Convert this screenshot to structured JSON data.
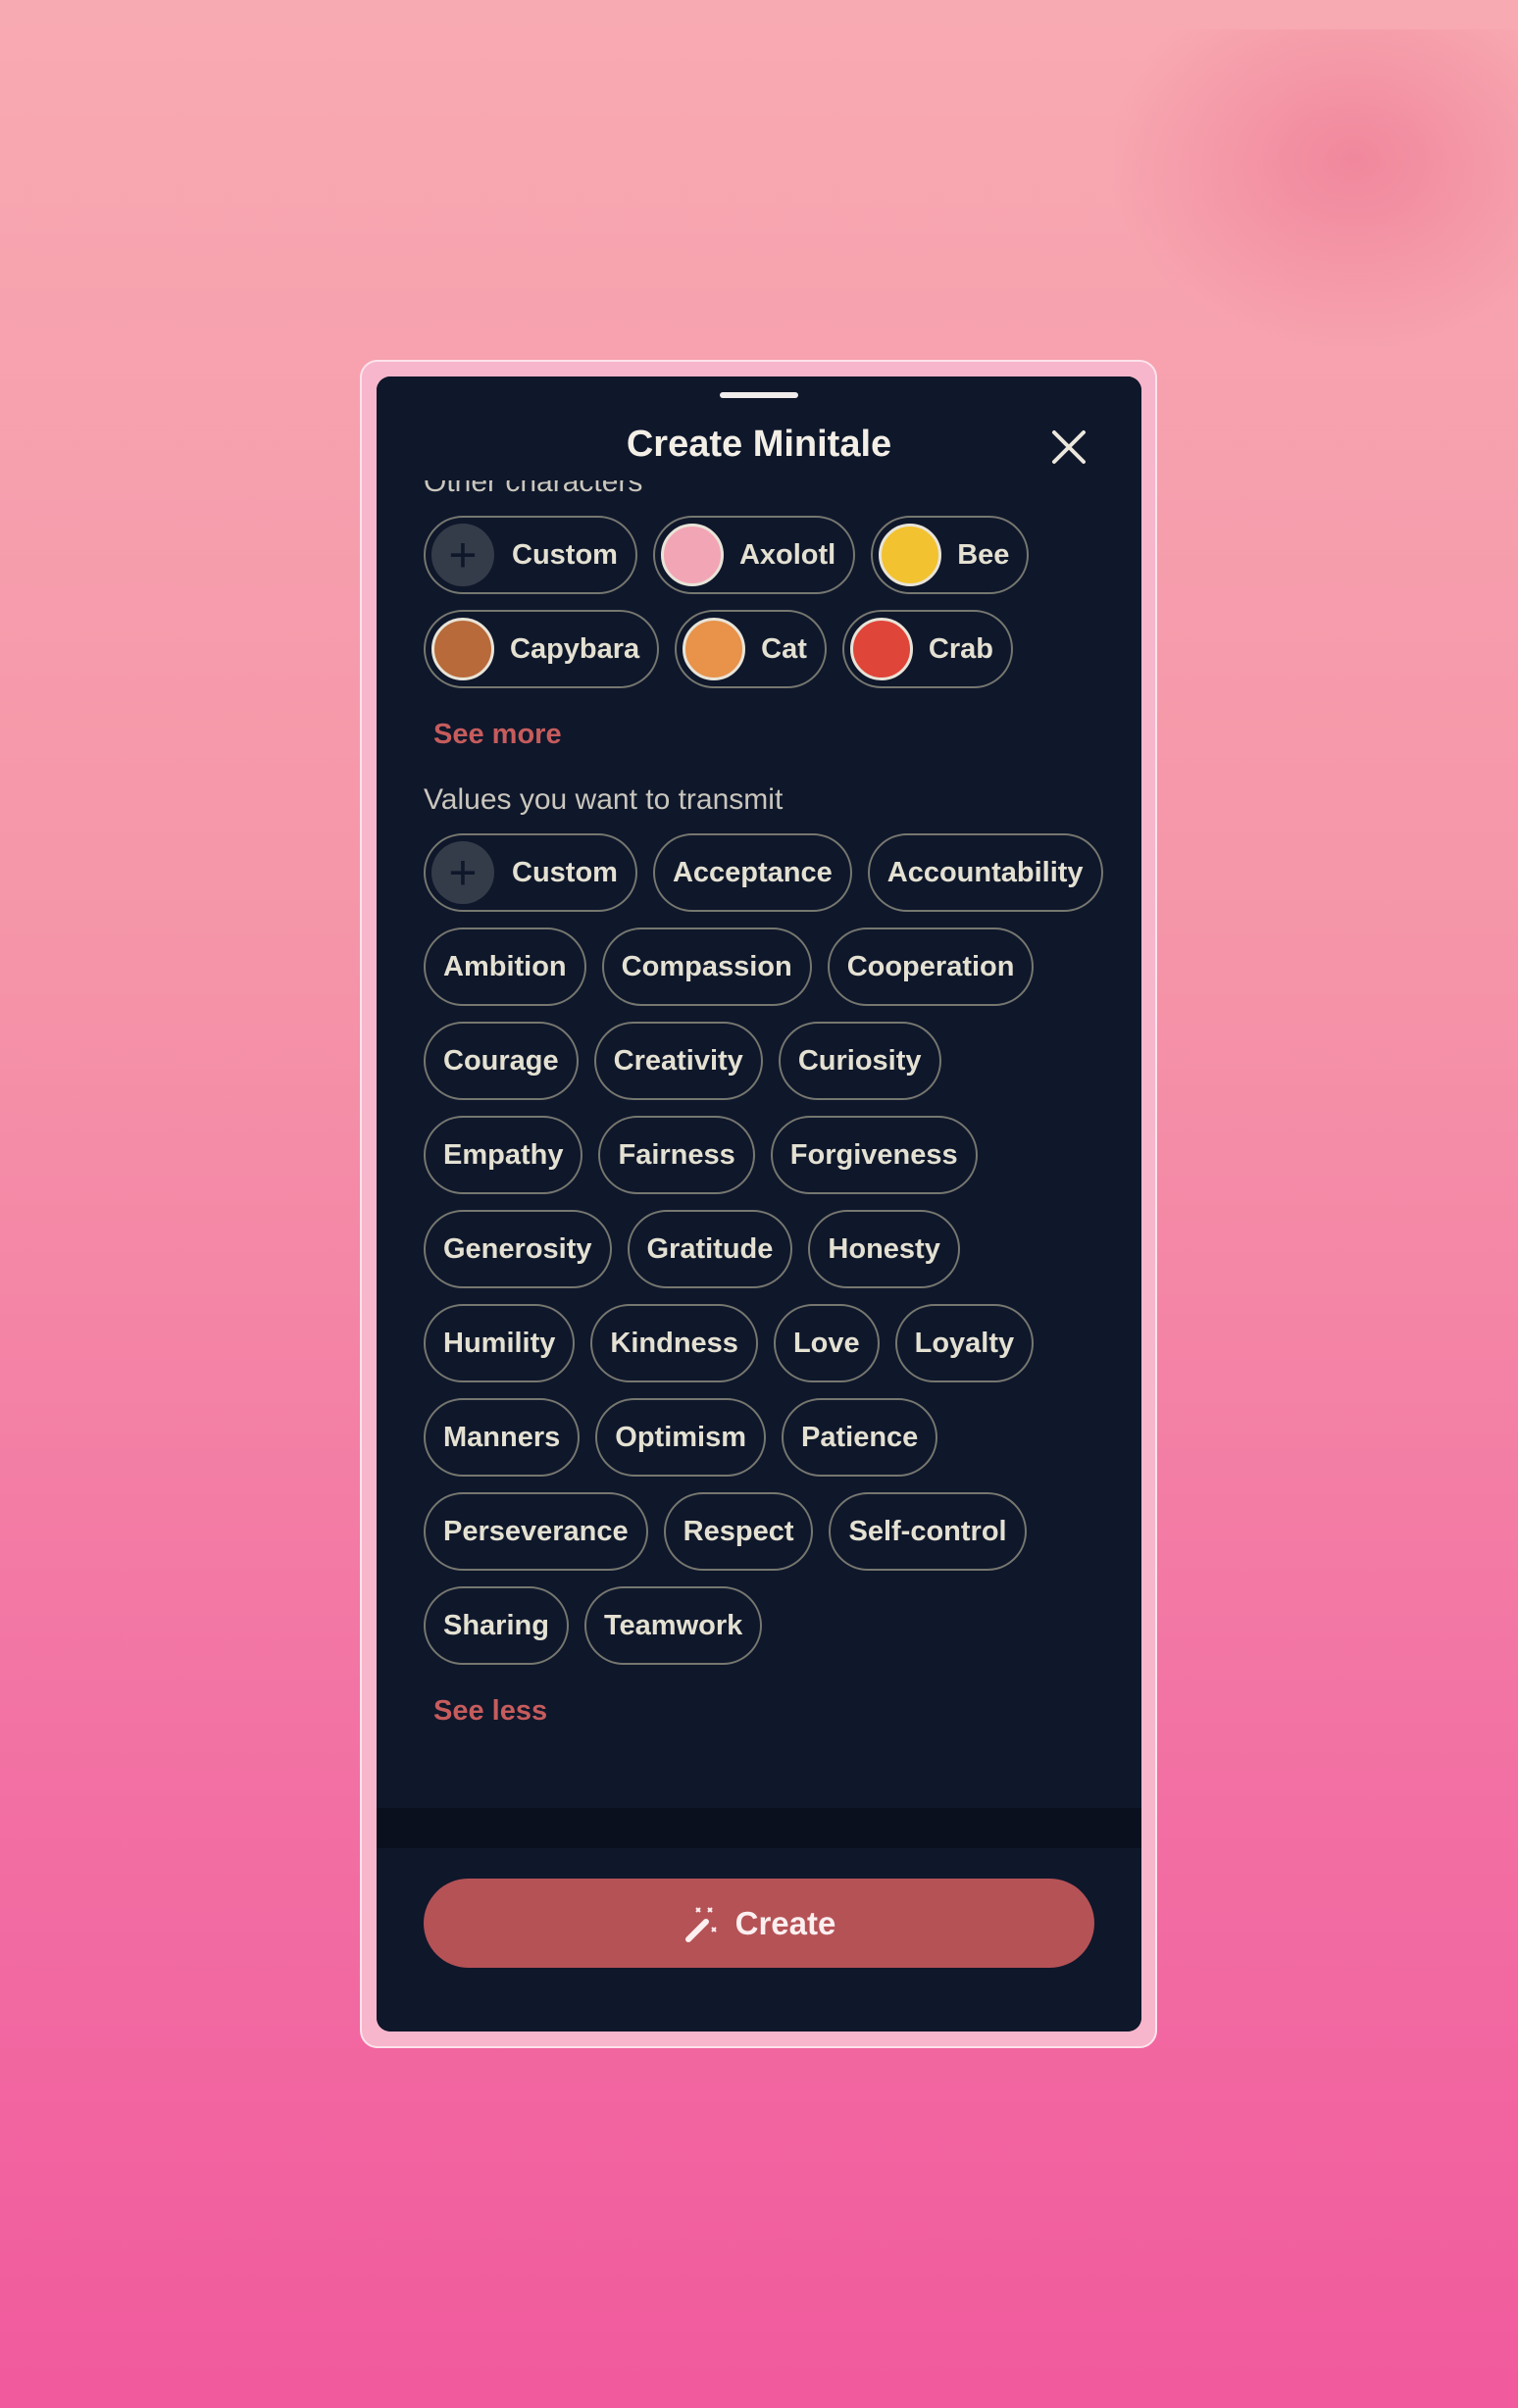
{
  "modal": {
    "title": "Create Minitale",
    "close_icon": "close-icon"
  },
  "characters": {
    "label": "Other characters",
    "items": [
      {
        "label": "Custom",
        "icon": "plus-icon"
      },
      {
        "label": "Axolotl",
        "icon": "axolotl-avatar",
        "color": "#f2a5b5"
      },
      {
        "label": "Bee",
        "icon": "bee-avatar",
        "color": "#f2c230"
      },
      {
        "label": "Capybara",
        "icon": "capybara-avatar",
        "color": "#b86a3a"
      },
      {
        "label": "Cat",
        "icon": "cat-avatar",
        "color": "#e8924a"
      },
      {
        "label": "Crab",
        "icon": "crab-avatar",
        "color": "#e0453a"
      }
    ],
    "see_more": "See more"
  },
  "values": {
    "label": "Values you want to transmit",
    "items": [
      "Custom",
      "Acceptance",
      "Accountability",
      "Ambition",
      "Compassion",
      "Cooperation",
      "Courage",
      "Creativity",
      "Curiosity",
      "Empathy",
      "Fairness",
      "Forgiveness",
      "Generosity",
      "Gratitude",
      "Honesty",
      "Humility",
      "Kindness",
      "Love",
      "Loyalty",
      "Manners",
      "Optimism",
      "Patience",
      "Perseverance",
      "Respect",
      "Self-control",
      "Sharing",
      "Teamwork"
    ],
    "see_less": "See less"
  },
  "footer": {
    "create_label": "Create",
    "create_icon": "magic-wand-icon"
  },
  "colors": {
    "accent": "#b55256",
    "link": "#c65c5c",
    "panel": "#0f172b"
  }
}
